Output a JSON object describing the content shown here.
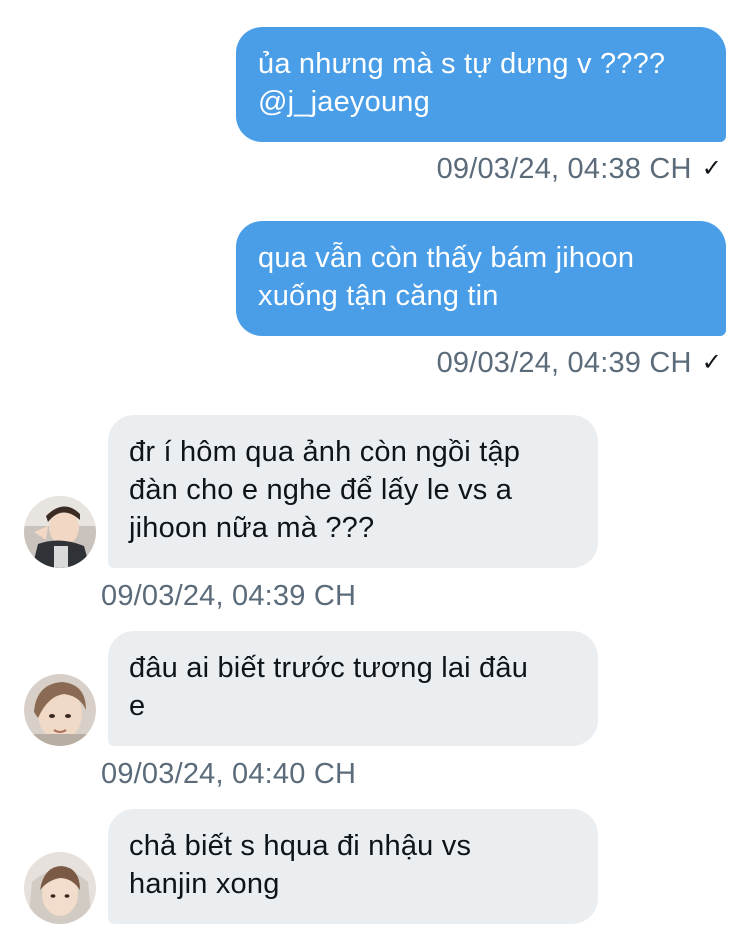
{
  "messages": [
    {
      "direction": "outgoing",
      "text": "ủa nhưng mà s tự dưng v ????\n@j_jaeyoung",
      "timestamp": "09/03/24, 04:38 CH",
      "read_icon": "checkmark-icon",
      "read_mark": "✓"
    },
    {
      "direction": "outgoing",
      "text": "qua vẫn còn thấy bám jihoon\nxuống tận căng tin",
      "timestamp": "09/03/24, 04:39 CH",
      "read_icon": "checkmark-icon",
      "read_mark": "✓"
    },
    {
      "direction": "incoming",
      "text": "đr í hôm qua ảnh còn ngồi tập\nđàn cho e nghe để lấy le vs a\njihoon nữa mà ???",
      "timestamp": "09/03/24, 04:39 CH"
    },
    {
      "direction": "incoming",
      "text": "đâu ai biết trước tương lai đâu\ne",
      "timestamp": "09/03/24, 04:40 CH"
    },
    {
      "direction": "incoming",
      "text": "chả biết s hqua đi nhậu vs\nhanjin xong"
    }
  ],
  "colors": {
    "outgoing_bubble": "#4a9ee8",
    "incoming_bubble": "#ebeef1",
    "timestamp_text": "#5b6b7a"
  }
}
